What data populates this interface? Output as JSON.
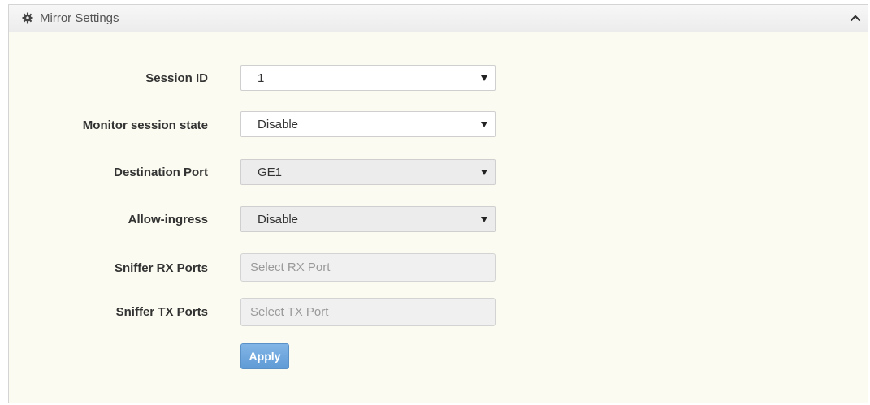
{
  "panel": {
    "title": "Mirror Settings",
    "header_icon": "gear-icon",
    "collapse_icon": "chevron-up-icon"
  },
  "form": {
    "session_id": {
      "label": "Session ID",
      "value": "1"
    },
    "monitor_session_state": {
      "label": "Monitor session state",
      "value": "Disable"
    },
    "destination_port": {
      "label": "Destination Port",
      "value": "GE1"
    },
    "allow_ingress": {
      "label": "Allow-ingress",
      "value": "Disable"
    },
    "sniffer_rx_ports": {
      "label": "Sniffer RX Ports",
      "placeholder": "Select RX Port"
    },
    "sniffer_tx_ports": {
      "label": "Sniffer TX Ports",
      "placeholder": "Select TX Port"
    },
    "apply_label": "Apply"
  },
  "colors": {
    "panel_background": "#fbfbf1",
    "button_blue": "#6ea7dd",
    "disabled_field": "#ececec"
  }
}
